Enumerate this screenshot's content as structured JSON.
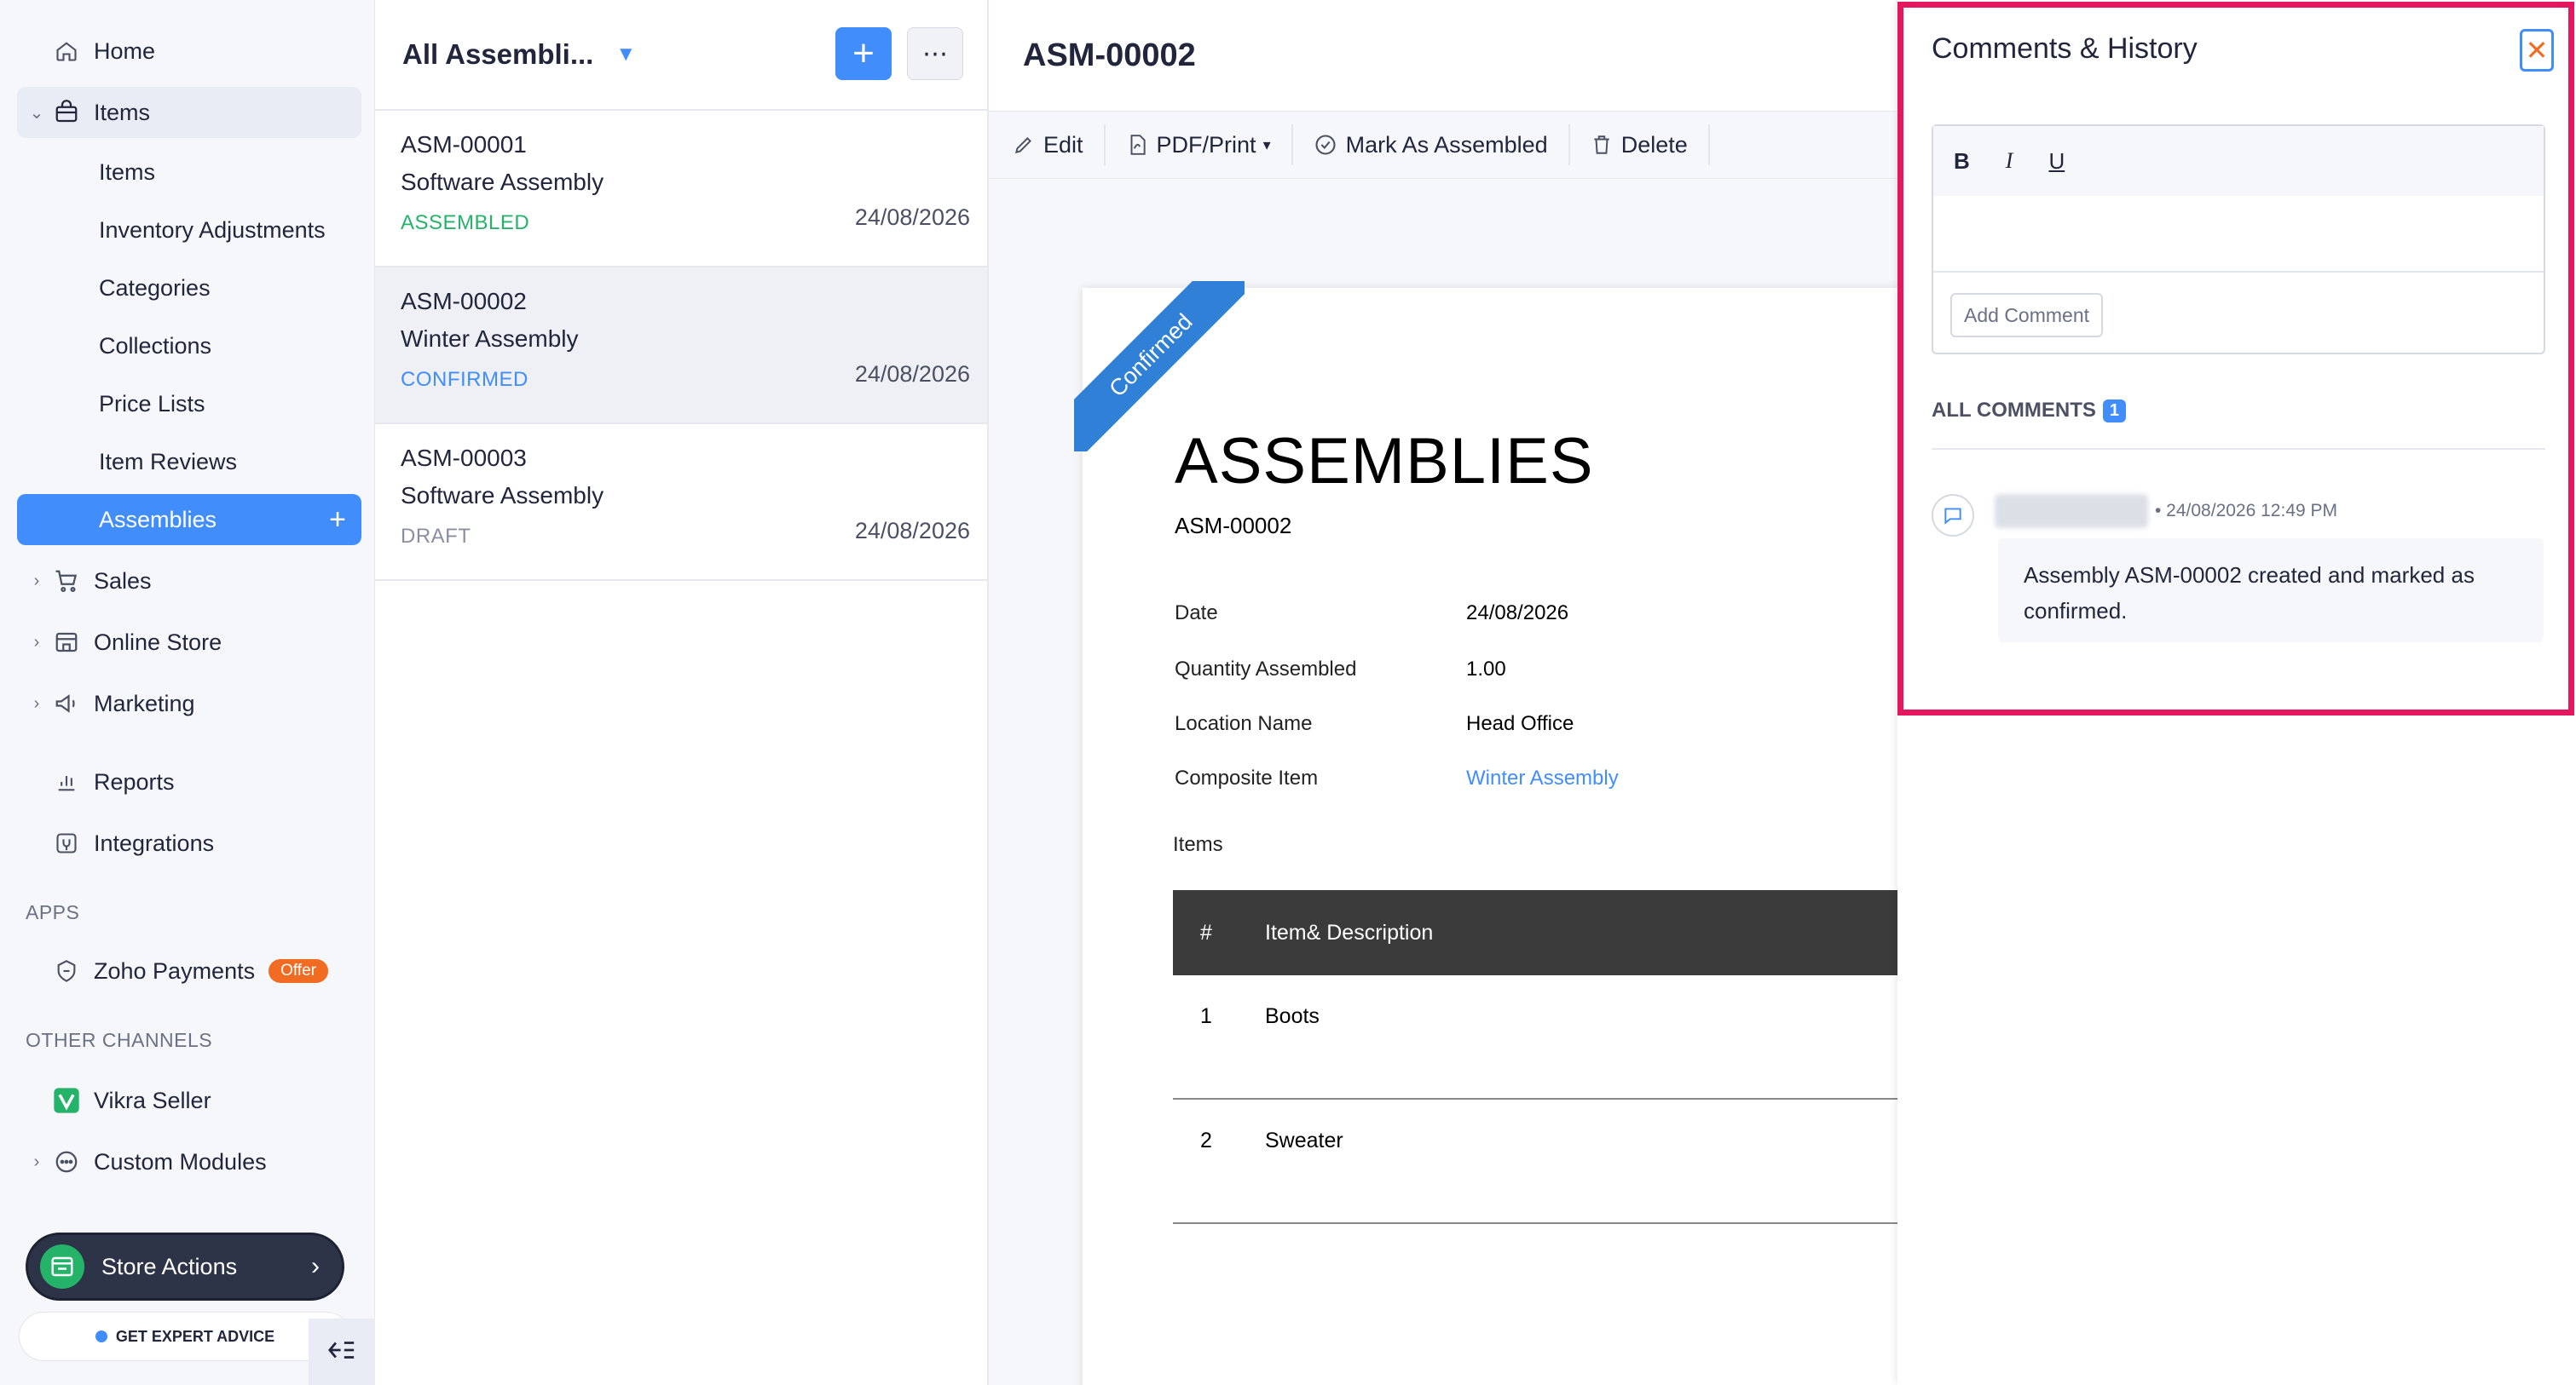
{
  "sidebar": {
    "home": "Home",
    "items_parent": "Items",
    "sub_items": [
      "Items",
      "Inventory Adjustments",
      "Categories",
      "Collections",
      "Price Lists",
      "Item Reviews"
    ],
    "assemblies": "Assemblies",
    "sales": "Sales",
    "online_store": "Online Store",
    "marketing": "Marketing",
    "reports": "Reports",
    "integrations": "Integrations",
    "apps_label": "APPS",
    "zoho_payments": "Zoho Payments",
    "offer_badge": "Offer",
    "other_channels_label": "OTHER CHANNELS",
    "vikra_seller": "Vikra Seller",
    "custom_modules": "Custom Modules",
    "store_actions": "Store Actions",
    "expert_advice": "GET EXPERT ADVICE"
  },
  "list": {
    "title": "All Assembli...",
    "rows": [
      {
        "number": "ASM-00001",
        "name": "Software Assembly",
        "status": "ASSEMBLED",
        "status_color": "#25b36a",
        "date": "24/08/2026"
      },
      {
        "number": "ASM-00002",
        "name": "Winter Assembly",
        "status": "CONFIRMED",
        "status_color": "#408dfb",
        "date": "24/08/2026"
      },
      {
        "number": "ASM-00003",
        "name": "Software Assembly",
        "status": "DRAFT",
        "status_color": "#8a8fa0",
        "date": "24/08/2026"
      }
    ]
  },
  "detail": {
    "title": "ASM-00002",
    "toolbar": {
      "edit": "Edit",
      "pdf": "PDF/Print",
      "mark": "Mark As Assembled",
      "delete": "Delete"
    },
    "ribbon": "Confirmed",
    "doc_title": "ASSEMBLIES",
    "doc_number": "ASM-00002",
    "fields": {
      "date_label": "Date",
      "date_value": "24/08/2026",
      "qty_label": "Quantity Assembled",
      "qty_value": "1.00",
      "location_label": "Location Name",
      "location_value": "Head Office",
      "composite_label": "Composite Item",
      "composite_value": "Winter Assembly"
    },
    "items_label": "Items",
    "table": {
      "col_num": "#",
      "col_item": "Item& Description",
      "rows": [
        {
          "num": "1",
          "item": "Boots"
        },
        {
          "num": "2",
          "item": "Sweater"
        }
      ]
    }
  },
  "comments": {
    "title": "Comments & History",
    "close": "✕",
    "bold": "B",
    "italic": "I",
    "underline": "U",
    "add_comment": "Add Comment",
    "all_comments": "ALL COMMENTS",
    "count": "1",
    "entry": {
      "meta": "• 24/08/2026 12:49 PM",
      "text": "Assembly ASM-00002 created and marked as confirmed."
    }
  },
  "colors": {
    "accent": "#408dfb",
    "highlight": "#e5175f",
    "offer": "#f26b22"
  }
}
